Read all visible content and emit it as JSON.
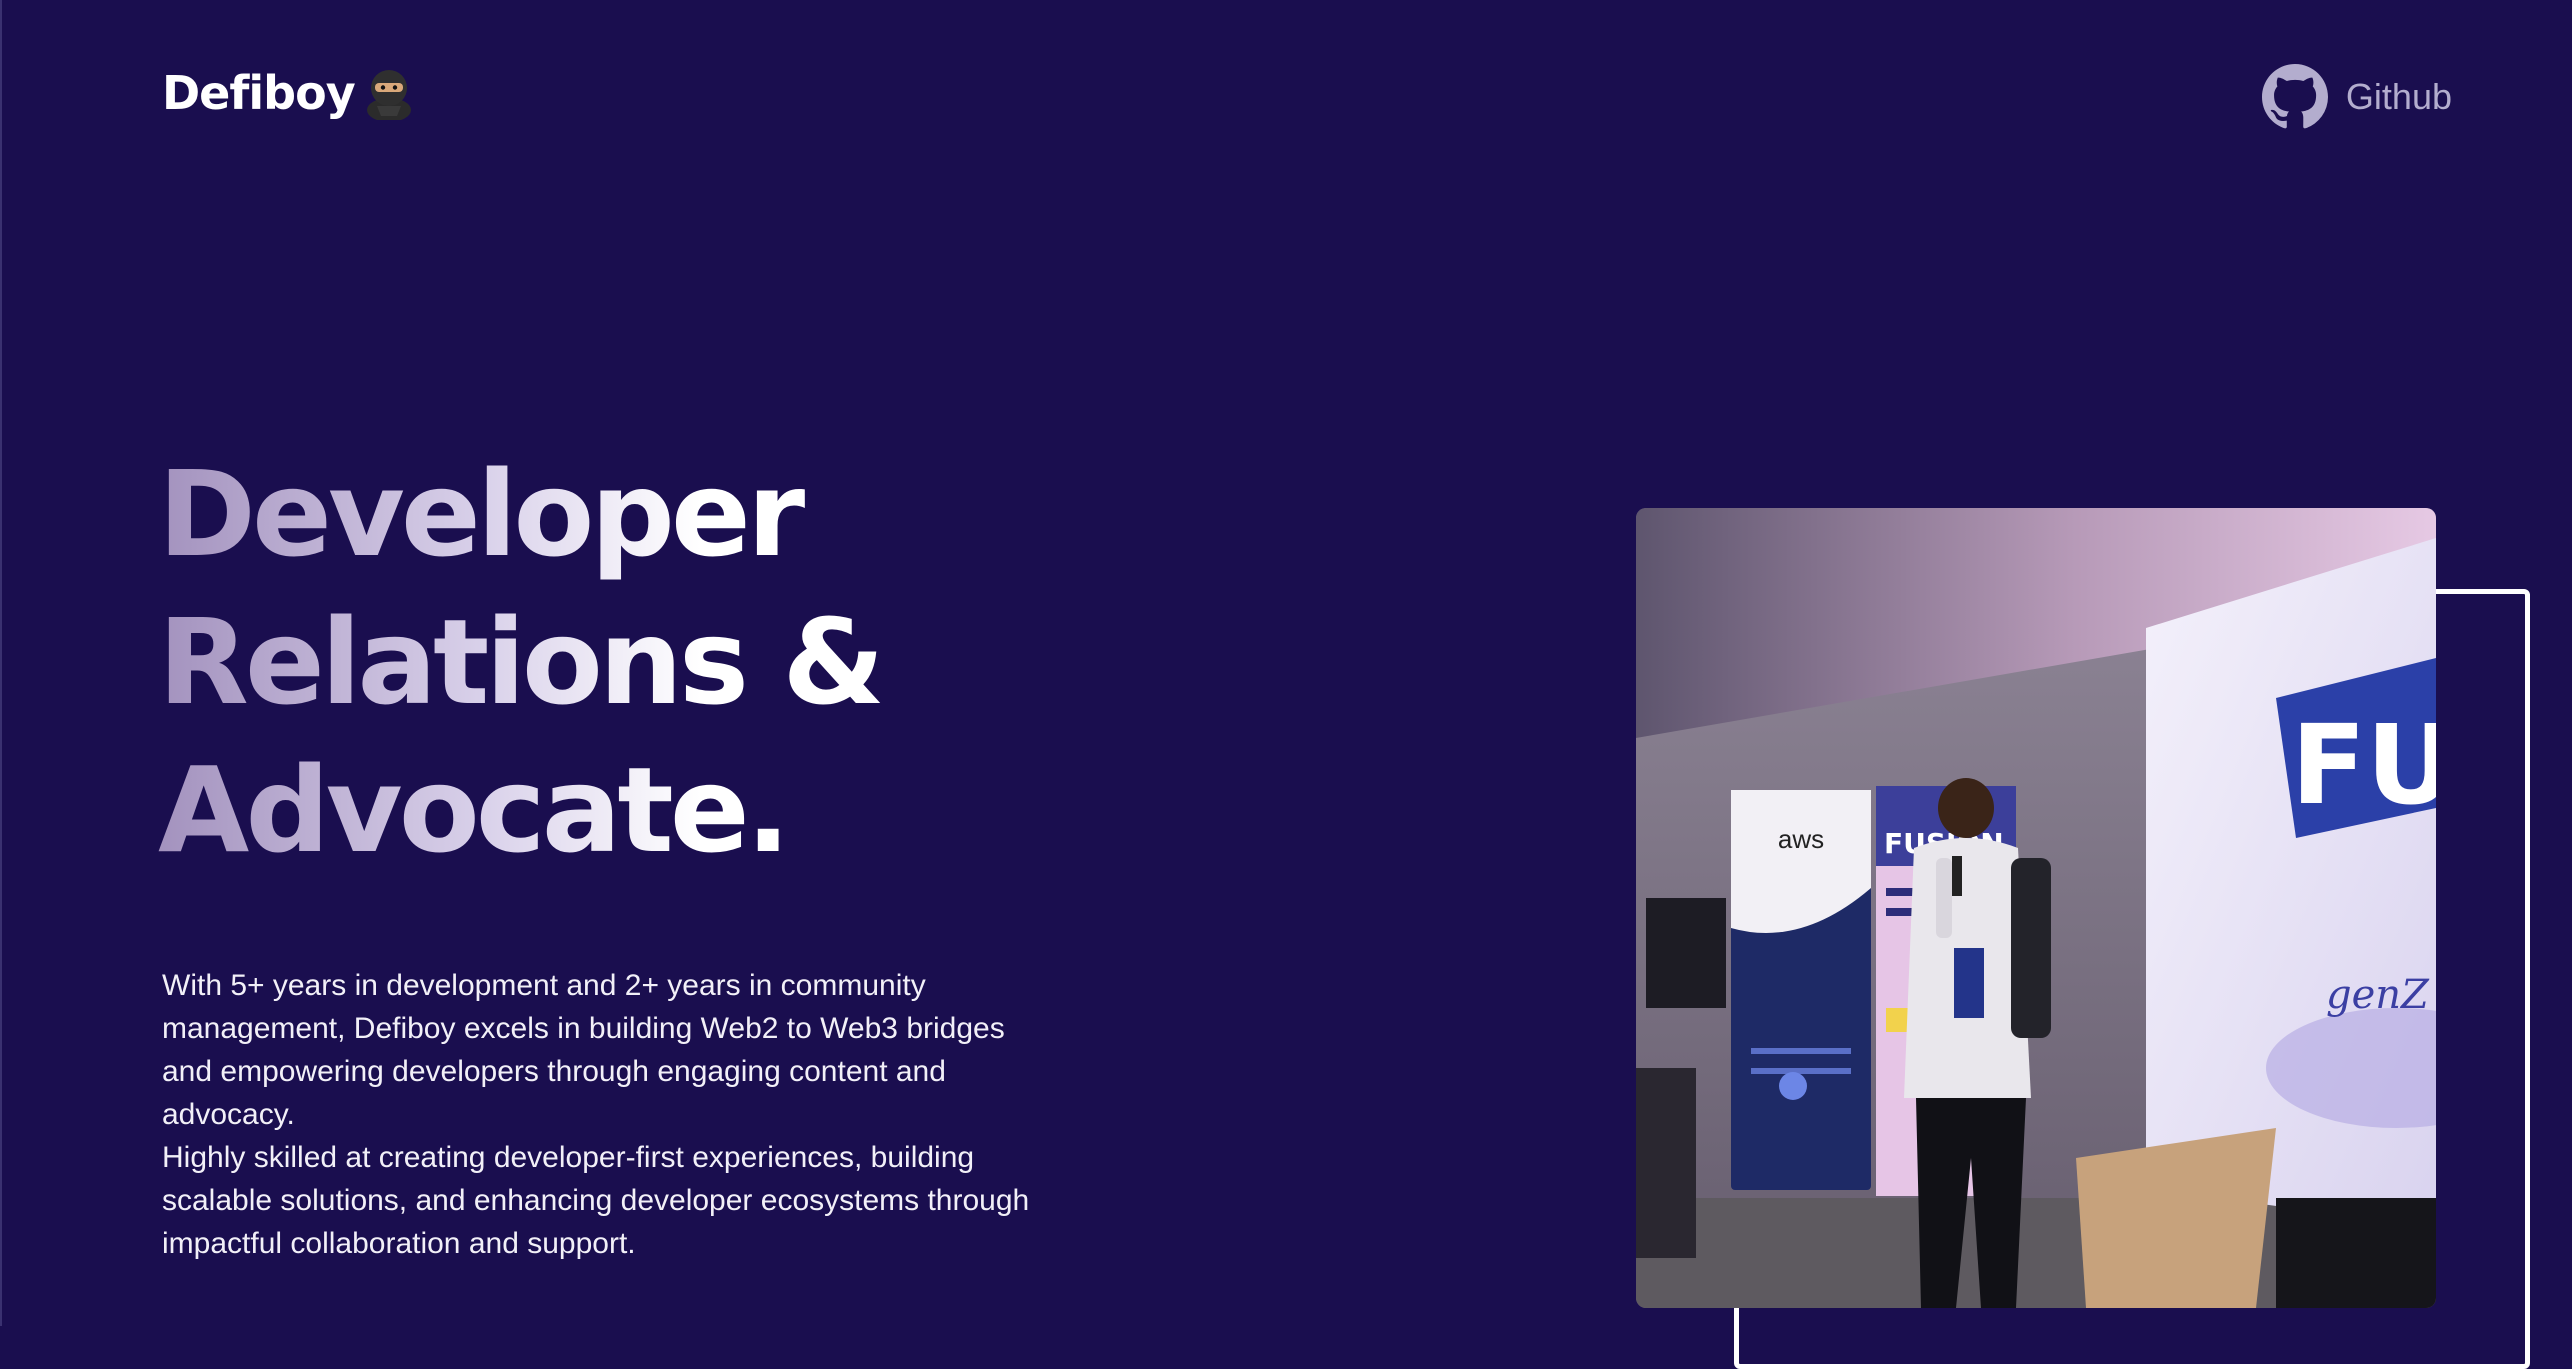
{
  "header": {
    "brand": "Defiboy",
    "brand_icon": "ninja-emoji",
    "github_label": "Github",
    "github_icon": "github-icon"
  },
  "hero": {
    "title_lines": [
      "Developer",
      "Relations &",
      "Advocate."
    ],
    "description": [
      "With 5+ years in development and 2+ years in community management, Defiboy excels in building Web2 to Web3 bridges and empowering developers through engaging content and advocacy.",
      "Highly skilled at creating developer-first experiences, building scalable solutions, and enhancing developer ecosystems through impactful collaboration and support."
    ]
  },
  "photo": {
    "banner_aws": "aws",
    "banner_fusion": "FUSION",
    "screen_text": "FUS",
    "screen_sub": "genZ techies"
  },
  "colors": {
    "background": "#1a0e4f",
    "text": "#ffffff",
    "muted": "#b3adce"
  }
}
